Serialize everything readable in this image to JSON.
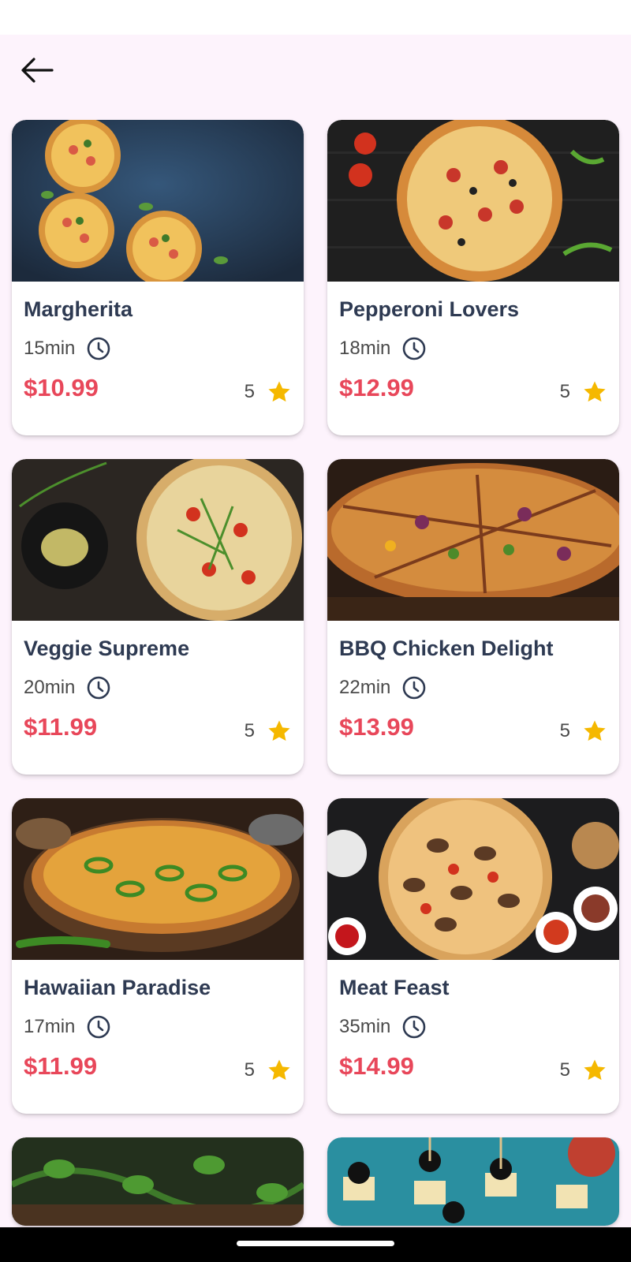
{
  "header": {
    "back_icon": "arrow-left-icon"
  },
  "accent_colors": {
    "price": "#e8475a",
    "star": "#f5b800",
    "title": "#2e3a52",
    "background": "#fdf3fc"
  },
  "items": [
    {
      "name": "Margherita",
      "time": "15min",
      "price": "$10.99",
      "rating": "5"
    },
    {
      "name": "Pepperoni Lovers",
      "time": "18min",
      "price": "$12.99",
      "rating": "5"
    },
    {
      "name": "Veggie Supreme",
      "time": "20min",
      "price": "$11.99",
      "rating": "5"
    },
    {
      "name": "BBQ Chicken Delight",
      "time": "22min",
      "price": "$13.99",
      "rating": "5"
    },
    {
      "name": "Hawaiian Paradise",
      "time": "17min",
      "price": "$11.99",
      "rating": "5"
    },
    {
      "name": "Meat Feast",
      "time": "35min",
      "price": "$14.99",
      "rating": "5"
    }
  ],
  "icons": {
    "time": "clock-icon",
    "rating": "star-icon"
  }
}
